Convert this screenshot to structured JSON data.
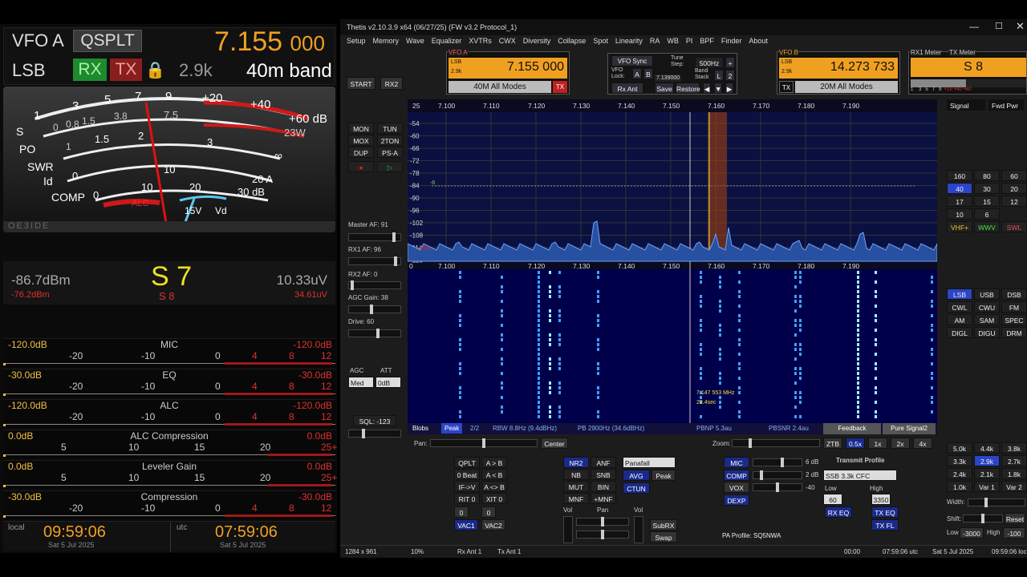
{
  "left": {
    "vfo_label": "VFO A",
    "qsplit": "QSPLT",
    "freq_main": "7.155",
    "freq_sub": "000",
    "mode": "LSB",
    "rx": "RX",
    "tx": "TX",
    "bw": "2.9k",
    "band": "40m band",
    "meter": {
      "s_scale": [
        "1",
        "3",
        "5",
        "7",
        "9",
        "+20",
        "+40",
        "+60 dB"
      ],
      "po_scale": [
        "0",
        "0.8",
        "1.5",
        "3.8",
        "7.5",
        "23W"
      ],
      "swr_scale": [
        "1",
        "1.5",
        "2",
        "3",
        "∞"
      ],
      "id_scale": [
        "0",
        "10",
        "20 A"
      ],
      "comp_scale": [
        "0",
        "10",
        "20",
        "30 dB"
      ],
      "vd": "15V",
      "vd_label": "Vd",
      "alc": "ALC",
      "row_s": "S",
      "row_po": "PO",
      "row_swr": "SWR",
      "row_id": "Id",
      "row_comp": "COMP",
      "brand": "OE3IDE"
    },
    "brand": "OE3IDE",
    "dbm": "-86.7dBm",
    "dbm_sub": "-76.2dBm",
    "smeter": "S 7",
    "smeter_sub": "S 8",
    "uv": "10.33uV",
    "uv_sub": "34.61uV",
    "rows": [
      {
        "name": "MIC",
        "left": "-120.0dB",
        "right": "-120.0dB",
        "ticks": [
          "-20",
          "-10",
          "0",
          "4",
          "8",
          "12"
        ]
      },
      {
        "name": "EQ",
        "left": "-30.0dB",
        "right": "-30.0dB",
        "ticks": [
          "-20",
          "-10",
          "0",
          "4",
          "8",
          "12"
        ]
      },
      {
        "name": "ALC",
        "left": "-120.0dB",
        "right": "-120.0dB",
        "ticks": [
          "-20",
          "-10",
          "0",
          "4",
          "8",
          "12"
        ]
      },
      {
        "name": "ALC Compression",
        "left": "0.0dB",
        "right": "0.0dB",
        "ticks": [
          "5",
          "10",
          "15",
          "20",
          "25+"
        ]
      },
      {
        "name": "Leveler Gain",
        "left": "0.0dB",
        "right": "0.0dB",
        "ticks": [
          "5",
          "10",
          "15",
          "20",
          "25+"
        ]
      },
      {
        "name": "Compression",
        "left": "-30.0dB",
        "right": "-30.0dB",
        "ticks": [
          "-20",
          "-10",
          "0",
          "4",
          "8",
          "12"
        ]
      }
    ],
    "local_label": "local",
    "local_time": "09:59:06",
    "local_date": "Sat 5 Jul 2025",
    "utc_label": "utc",
    "utc_time": "07:59:06",
    "utc_date": "Sat 5 Jul 2025"
  },
  "app": {
    "title": "Thetis v2.10.3.9 x64 (06/27/25) (FW v3.2 Protocol_1)",
    "menu": [
      "Setup",
      "Memory",
      "Wave",
      "Equalizer",
      "XVTRs",
      "CWX",
      "Diversity",
      "Collapse",
      "Spot",
      "Linearity",
      "RA",
      "WB",
      "PI",
      "BPF",
      "Finder",
      "About"
    ],
    "vfoa": {
      "label": "VFO A",
      "freq": "7.155 000",
      "mode": "LSB",
      "bw": "2.9k",
      "band": "40M All Modes",
      "tx": "TX"
    },
    "vfob": {
      "label": "VFO B",
      "freq": "14.273 733",
      "mode": "LSB",
      "bw": "2.9k",
      "band": "20M All Modes",
      "tx": "TX"
    },
    "sync": {
      "vfo_sync": "VFO Sync",
      "tune_step": "Tune Step:",
      "step": "500Hz",
      "vfo_lock": "VFO Lock:",
      "a": "A",
      "b": "B",
      "lock_freq": "7.139000",
      "band_stack": "Band Stack",
      "l": "L",
      "two": "2",
      "rx_ant": "Rx Ant",
      "save": "Save",
      "restore": "Restore"
    },
    "rx1meter": "RX1 Meter",
    "txmeter": "TX Meter",
    "s8": "S 8",
    "meter_sel": "Signal",
    "fwd": "Fwd Pwr",
    "meter_scale": [
      "1",
      "3",
      "5",
      "7",
      "9",
      "+20",
      "+40",
      "+60"
    ],
    "start": "START",
    "rx2": "RX2",
    "left_btns": [
      [
        "MON",
        "TUN"
      ],
      [
        "MOX",
        "2TON"
      ],
      [
        "DUP",
        "PS-A"
      ]
    ],
    "master_af": "Master AF:  91",
    "rx1_af": "RX1 AF:  96",
    "rx2_af": "RX2 AF:  0",
    "agc_gain": "AGC Gain:  38",
    "drive": "Drive:  60",
    "agc": "AGC",
    "att": "ATT",
    "agc_val": "Med",
    "att_val": "0dB",
    "sql": "SQL: -123",
    "freqs": [
      "7.100",
      "7.110",
      "7.120",
      "7.130",
      "7.140",
      "7.150",
      "7.160",
      "7.170",
      "7.180",
      "7.190"
    ],
    "db_scale": [
      "-54",
      "-60",
      "-66",
      "-72",
      "-78",
      "-84",
      "-90",
      "-96",
      "-102",
      "-108",
      "-114",
      "-120"
    ],
    "db_top": "25",
    "db_marker": "-6",
    "zero": "0",
    "wf_note1": "7.147 553 MHz",
    "wf_note2": "28.4sec",
    "blobs": "Blobs",
    "peak": "Peak",
    "pg": "2/2",
    "rbw": "RBW 8.8Hz (9.4dBHz)",
    "pb": "PB 2900Hz (34.6dBHz)",
    "pbnp": "PBNP 5.3au",
    "pbsnr": "PBSNR 2.4au",
    "feedback": "Feedback",
    "puresignal": "Pure Signal2",
    "pan": "Pan:",
    "center": "Center",
    "zoom": "Zoom:",
    "ztb": "ZTB",
    "zooms": [
      "0.5x",
      "1x",
      "2x",
      "4x"
    ],
    "bands": [
      [
        "160",
        "80",
        "60"
      ],
      [
        "40",
        "30",
        "20"
      ],
      [
        "17",
        "15",
        "12"
      ],
      [
        "10",
        "6",
        ""
      ],
      [
        "VHF+",
        "WWV",
        "SWL"
      ]
    ],
    "modes": [
      [
        "LSB",
        "USB",
        "DSB"
      ],
      [
        "CWL",
        "CWU",
        "FM"
      ],
      [
        "AM",
        "SAM",
        "SPEC"
      ],
      [
        "DIGL",
        "DIGU",
        "DRM"
      ]
    ],
    "filters": [
      [
        "5.0k",
        "4.4k",
        "3.8k"
      ],
      [
        "3.3k",
        "2.9k",
        "2.7k"
      ],
      [
        "2.4k",
        "2.1k",
        "1.8k"
      ],
      [
        "1.0k",
        "Var 1",
        "Var 2"
      ]
    ],
    "width": "Width:",
    "shift": "Shift:",
    "reset": "Reset",
    "low": "Low",
    "high": "High",
    "low_v": "-3000",
    "high_v": "-100",
    "qplt": [
      [
        "QPLT",
        "A > B"
      ],
      [
        "0 Beat",
        "A < B"
      ],
      [
        "IF->V",
        "A <> B"
      ],
      [
        "RIT  0",
        "XIT  0"
      ]
    ],
    "vac": [
      "VAC1",
      "VAC2"
    ],
    "dsp": [
      [
        "NR2",
        "ANF"
      ],
      [
        "NB",
        "SNB"
      ],
      [
        "MUT",
        "BIN"
      ],
      [
        "MNF",
        "+MNF"
      ]
    ],
    "panafall": "Panafall",
    "avg": "AVG",
    "peak2": "Peak",
    "ctun": "CTUN",
    "vol": "Vol",
    "pan2": "Pan",
    "subrx": "SubRX",
    "swap": "Swap",
    "mic": "MIC",
    "comp": "COMP",
    "vox": "VOX",
    "dexp": "DEXP",
    "mic_db": "6 dB",
    "comp_db": "2 dB",
    "vox_db": "-40",
    "tx_profile": "Transmit Profile",
    "profile_val": "SSB 3.3k CFC",
    "low2": "Low",
    "high2": "High",
    "low2_v": "60",
    "high2_v": "3350",
    "rxeq": "RX EQ",
    "txeq": "TX EQ",
    "txfl": "TX FL",
    "pa": "PA Profile: SQ5NWA",
    "status": [
      "1284 x 961",
      "10%",
      "Rx Ant  1",
      "Tx Ant  1",
      "00:00",
      "07:59:06 utc",
      "Sat 5 Jul 2025",
      "09:59:06 loc"
    ]
  },
  "colors": {
    "accent": "#f0a020",
    "blue": "#2c44c8",
    "red": "#e03030"
  }
}
